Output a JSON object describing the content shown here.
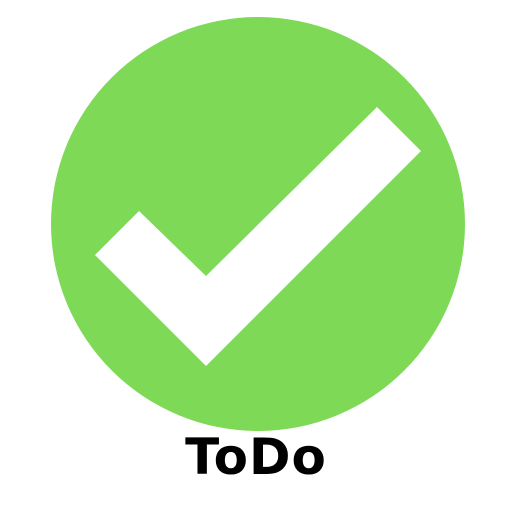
{
  "app": {
    "title": "ToDo"
  },
  "icon": {
    "name": "checkmark-icon",
    "background_color": "#7ed957",
    "check_color": "#ffffff"
  }
}
